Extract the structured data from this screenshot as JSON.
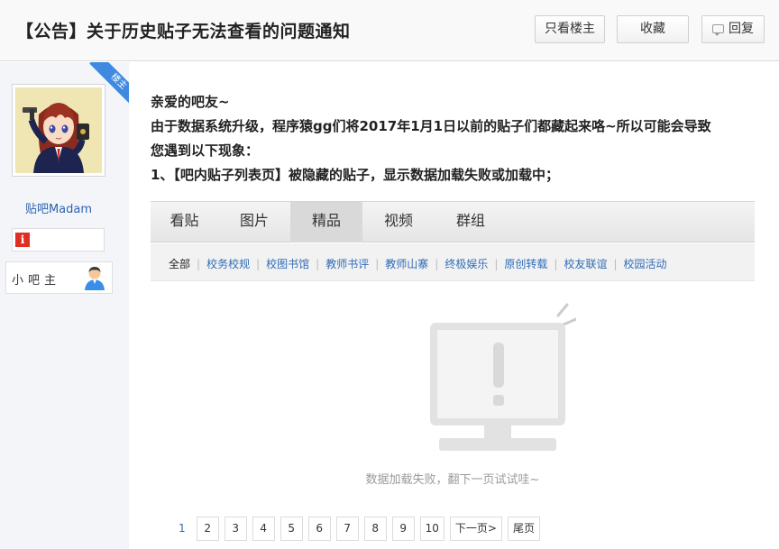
{
  "header": {
    "title": "【公告】关于历史贴子无法查看的问题通知",
    "buttons": {
      "only_op": "只看楼主",
      "favorite": "收藏",
      "reply": "回复"
    }
  },
  "author": {
    "ribbon": "楼主",
    "username": "贴吧Madam",
    "badge_icon": "i",
    "role": "小吧主",
    "avatar_icon": "anime-avatar",
    "role_icon": "user-icon"
  },
  "post": {
    "lines": [
      "亲爱的吧友~",
      "由于数据系统升级，程序猿gg们将2017年1月1日以前的贴子们都藏起来咯~所以可能会导致",
      "您遇到以下现象：",
      "1、【吧内贴子列表页】被隐藏的贴子，显示数据加载失败或加载中；"
    ]
  },
  "embedded": {
    "tabs": [
      {
        "label": "看贴",
        "active": false
      },
      {
        "label": "图片",
        "active": false
      },
      {
        "label": "精品",
        "active": true
      },
      {
        "label": "视频",
        "active": false
      },
      {
        "label": "群组",
        "active": false
      }
    ],
    "subnav": [
      "全部",
      "校务校规",
      "校图书馆",
      "教师书评",
      "教师山寨",
      "终极娱乐",
      "原创转载",
      "校友联谊",
      "校园活动"
    ],
    "empty_icon": "monitor-alert-icon",
    "empty_text": "数据加载失败，翻下一页试试哇~",
    "pagination": {
      "current": "1",
      "pages": [
        "2",
        "3",
        "4",
        "5",
        "6",
        "7",
        "8",
        "9",
        "10"
      ],
      "next": "下一页>",
      "last": "尾页"
    }
  },
  "colors": {
    "link_blue": "#2f6cb6",
    "ribbon_blue": "#3f8ae0",
    "badge_red": "#e02e24"
  }
}
